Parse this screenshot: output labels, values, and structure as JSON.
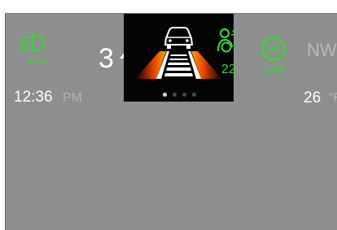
{
  "headlight": {
    "icon": "auto-headlight-icon",
    "label": "AUTO"
  },
  "gear": {
    "value": "3",
    "icon": "shift-up-arrow-icon"
  },
  "clock": {
    "time": "12:36",
    "period": "PM"
  },
  "center_panel": {
    "icons": [
      "car-ahead-icon",
      "lane-road-icon",
      "driver-assist-icon"
    ],
    "assist_value": "22",
    "pages": 4,
    "active_page": 1
  },
  "speed_limit": {
    "value": "60",
    "label": "LIM"
  },
  "compass": {
    "heading": "NW"
  },
  "temperature": {
    "value": "26",
    "unit": "°F"
  },
  "colors": {
    "background": "#8e8e8e",
    "accent": "#3ed13e",
    "text": "#ffffff"
  }
}
